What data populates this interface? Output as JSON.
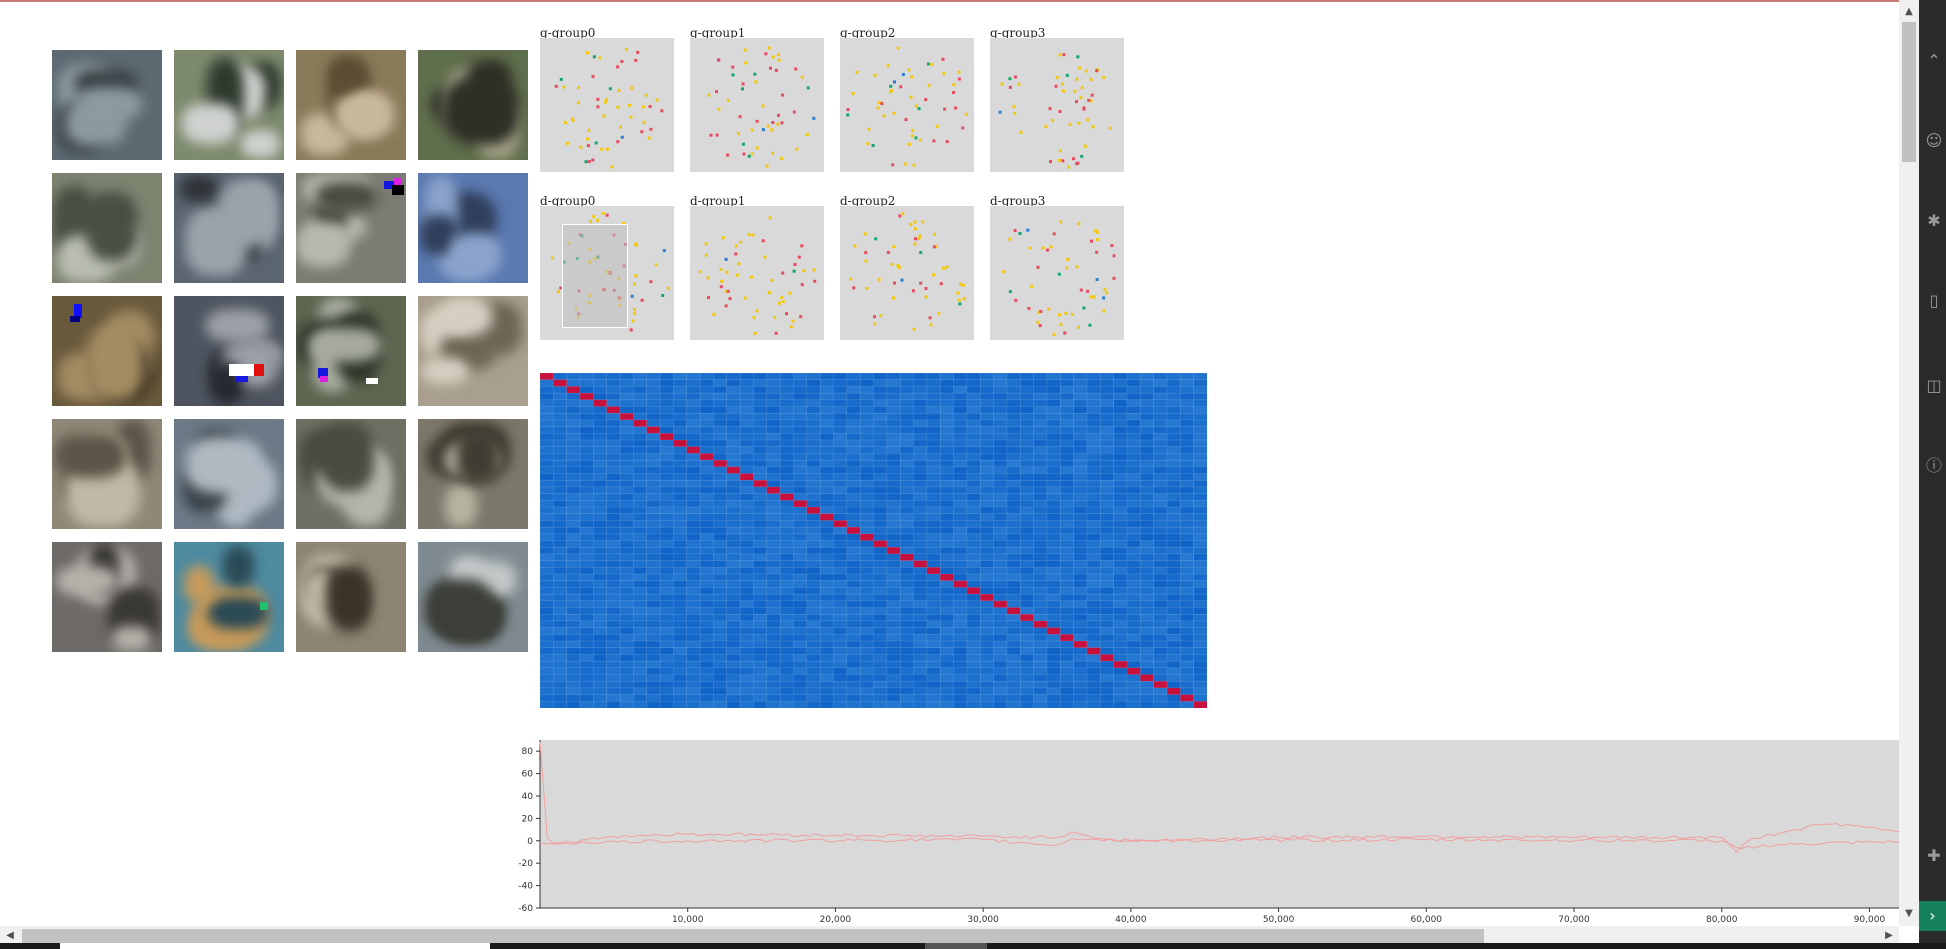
{
  "colors": {
    "panel_bg": "#d9d9d9",
    "heat_base": "#1a6fd0",
    "heat_diag": "#c8103c",
    "line_bg": "#d9d9d9",
    "line_series": "#f0a0a0",
    "dot_palette": [
      "#f2c80f",
      "#e84a5f",
      "#13a86a",
      "#2a7fd4"
    ]
  },
  "image_grid": {
    "rows": 5,
    "cols": 4,
    "icon": "generated-image-thumbnail"
  },
  "scatter_panels": {
    "g_groups": [
      {
        "label": "g-group0"
      },
      {
        "label": "g-group1"
      },
      {
        "label": "g-group2"
      },
      {
        "label": "g-group3"
      }
    ],
    "d_groups": [
      {
        "label": "d-group0"
      },
      {
        "label": "d-group1"
      },
      {
        "label": "d-group2"
      },
      {
        "label": "d-group3"
      }
    ]
  },
  "heatmap": {
    "rows": 50,
    "cols": 50,
    "diagonal_highlight": true
  },
  "chart_data": {
    "type": "line",
    "title": "",
    "xlabel": "",
    "ylabel": "",
    "xlim": [
      0,
      92000
    ],
    "ylim": [
      -60,
      90
    ],
    "x_ticks": [
      "10,000",
      "20,000",
      "30,000",
      "40,000",
      "50,000",
      "60,000",
      "70,000",
      "80,000",
      "90,000"
    ],
    "y_ticks": [
      "80",
      "60",
      "40",
      "20",
      "0",
      "-20",
      "-40",
      "-60"
    ],
    "grid": false,
    "series": [
      {
        "x": [
          0,
          500,
          1000,
          5000,
          10000,
          20000,
          30000,
          35000,
          36000,
          38000,
          40000,
          50000,
          60000,
          70000,
          80000,
          81000,
          82000,
          85000,
          87000,
          90000,
          92000
        ],
        "values": [
          88,
          2,
          -3,
          4,
          6,
          5,
          4,
          3,
          8,
          2,
          0,
          3,
          4,
          3,
          3,
          -10,
          2,
          10,
          15,
          12,
          8
        ]
      },
      {
        "x": [
          0,
          1000,
          10000,
          30000,
          35000,
          36000,
          40000,
          60000,
          80000,
          81000,
          85000,
          92000
        ],
        "values": [
          -2,
          -2,
          0,
          1,
          -4,
          2,
          0,
          1,
          0,
          -6,
          -3,
          -1
        ]
      }
    ]
  },
  "scrollbars": {
    "up_arrow": "▲",
    "down_arrow": "▼",
    "left_arrow": "◀",
    "right_arrow": "▶"
  },
  "sidebar": {
    "bottom_icon": "›"
  }
}
